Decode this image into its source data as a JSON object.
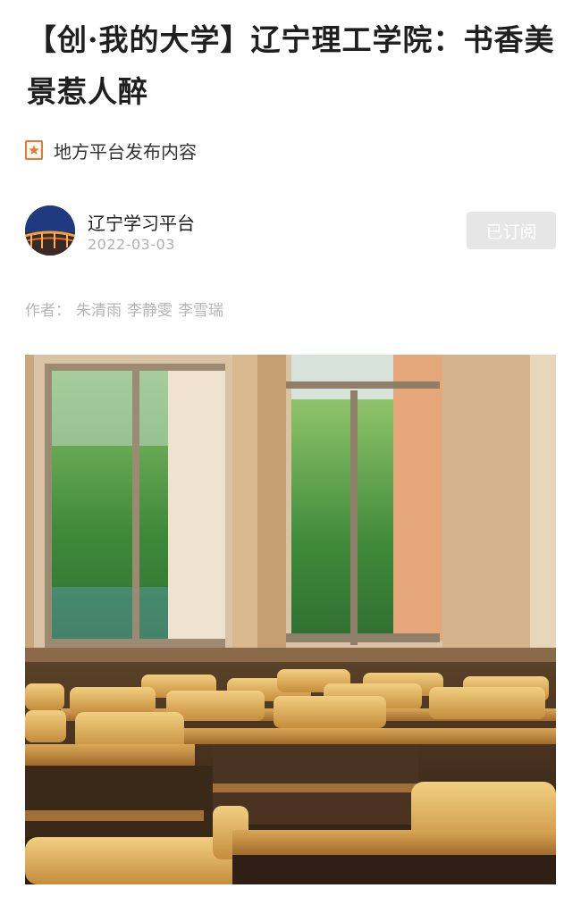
{
  "article": {
    "title": "【创·我的大学】辽宁理工学院：书香美景惹人醉",
    "source_label": "地方平台发布内容",
    "source_icon": "star-badge-icon"
  },
  "channel": {
    "name": "辽宁学习平台",
    "date": "2022-03-03",
    "subscribe_label": "已订阅",
    "avatar": "avatar-bridge-night-photo"
  },
  "byline": {
    "prefix": "作者：",
    "authors": [
      "朱清雨",
      "李静雯",
      "李雪瑞"
    ]
  },
  "photo": {
    "description_icon": "classroom-photo"
  },
  "colors": {
    "accent_orange": "#e07a3a",
    "muted_gray": "#b5b5b5",
    "button_gray": "#e6e6e6"
  }
}
